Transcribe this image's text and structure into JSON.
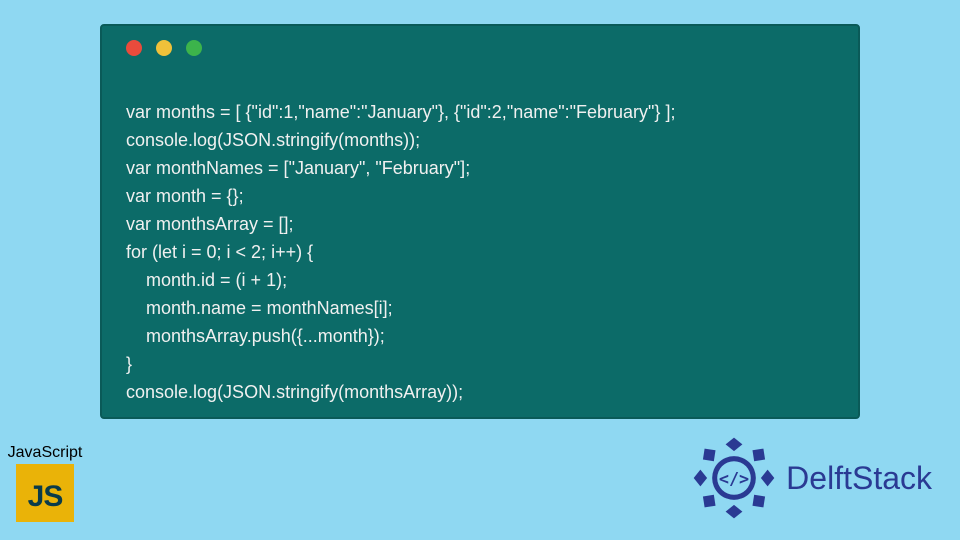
{
  "code": {
    "lines": [
      "var months = [ {\"id\":1,\"name\":\"January\"}, {\"id\":2,\"name\":\"February\"} ];",
      "console.log(JSON.stringify(months));",
      "var monthNames = [\"January\", \"February\"];",
      "var month = {};",
      "var monthsArray = [];",
      "for (let i = 0; i < 2; i++) {",
      "    month.id = (i + 1);",
      "    month.name = monthNames[i];",
      "    monthsArray.push({...month});",
      "}",
      "console.log(JSON.stringify(monthsArray));"
    ]
  },
  "window": {
    "dot_colors": {
      "red": "#e94b3c",
      "yellow": "#f0c13a",
      "green": "#3cb44b"
    },
    "bg": "#0c6b68"
  },
  "js_badge": {
    "label": "JavaScript",
    "tile_text": "JS"
  },
  "brand": {
    "name": "DelftStack",
    "logo_color": "#2a3a93"
  },
  "page": {
    "bg": "#8fd8f2"
  }
}
